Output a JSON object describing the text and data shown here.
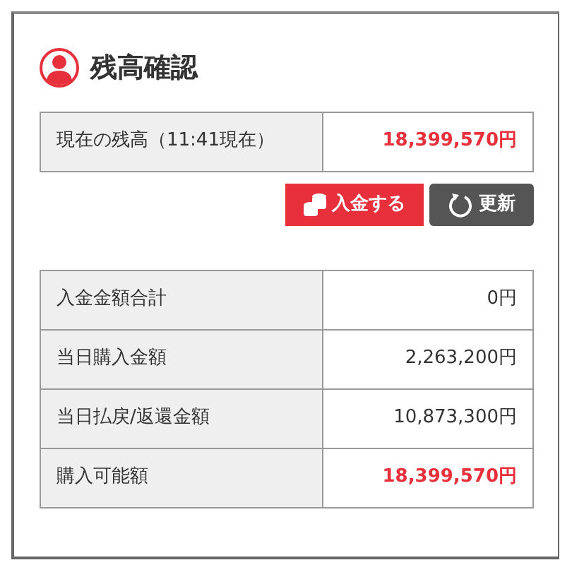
{
  "title": "残高確認",
  "balance": [
    {
      "label": "現在の残高（11:41現在）",
      "value": "18,399,570円",
      "emphasis": true
    }
  ],
  "buttons": [
    {
      "kind": "deposit",
      "label": "入金する"
    },
    {
      "kind": "refresh",
      "label": "更新"
    }
  ],
  "summary": [
    {
      "label": "入金金額合計",
      "value": "0円",
      "emphasis": false
    },
    {
      "label": "当日購入金額",
      "value": "2,263,200円",
      "emphasis": false
    },
    {
      "label": "当日払戻/返還金額",
      "value": "10,873,300円",
      "emphasis": false
    },
    {
      "label": "購入可能額",
      "value": "18,399,570円",
      "emphasis": true
    }
  ]
}
